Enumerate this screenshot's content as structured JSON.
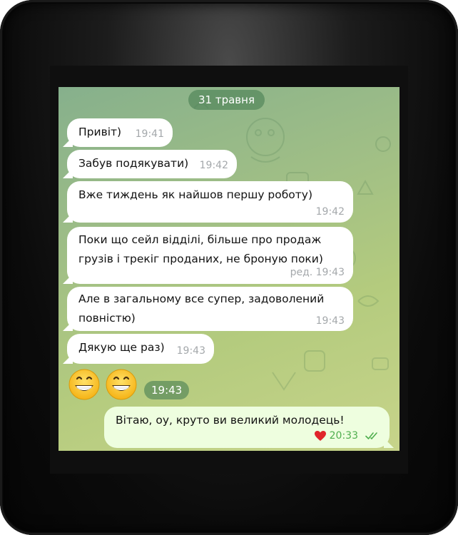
{
  "chat": {
    "date_chip": "31 травня",
    "messages": [
      {
        "text": "Привіт)",
        "time": "19:41"
      },
      {
        "text": "Забув подякувати)",
        "time": "19:42"
      },
      {
        "text": "Вже тиждень як найшов першу роботу)",
        "time": "19:42"
      },
      {
        "lines": [
          "Поки що сейл відділі, більше про продаж",
          "грузів і трекіг проданих, не броную поки)"
        ],
        "time": "ред. 19:43"
      },
      {
        "lines": [
          "Але в загальному все супер, задоволений",
          "повністю)"
        ],
        "time": "19:43"
      },
      {
        "text": "Дякую ще раз)",
        "time": "19:43"
      }
    ],
    "emoji_message": {
      "emoji_icons": [
        "grinning-face-icon",
        "grinning-face-icon"
      ],
      "time": "19:43"
    },
    "outgoing": {
      "text": "Вітаю, оу, круто ви великий молодець!",
      "reaction_icon": "red-heart-icon",
      "time": "20:33",
      "status_icon": "double-check-icon"
    }
  },
  "colors": {
    "incoming_bubble": "#ffffff",
    "outgoing_bubble": "#eefedf",
    "timestamp_gray": "#a4a8ab",
    "timestamp_green": "#4fae4e",
    "reaction_heart": "#e0252b",
    "chip_background": "#4a8054"
  }
}
